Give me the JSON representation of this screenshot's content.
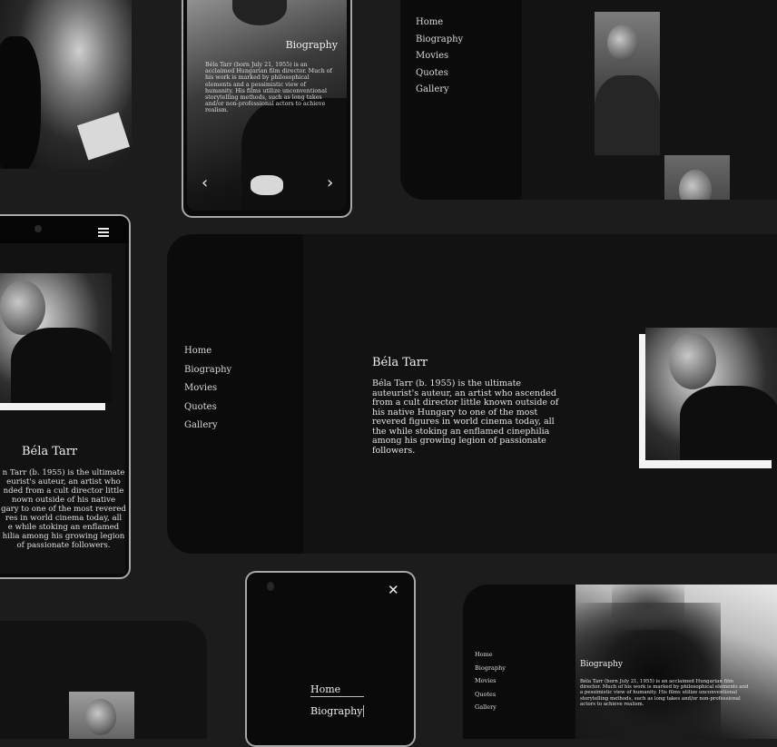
{
  "nav": {
    "items": [
      "Home",
      "Biography",
      "Movies",
      "Quotes",
      "Gallery"
    ]
  },
  "main": {
    "title": "Béla Tarr",
    "paragraph": "Béla Tarr (b. 1955) is the ultimate auteurist's auteur, an artist who ascended from a cult director little known outside of his native Hungary to one of the most revered figures in world cinema today, all the while stoking an enflamed cinephilia among his growing legion of passionate followers."
  },
  "mobile_left": {
    "title": "Béla Tarr",
    "lines": [
      "n Tarr (b. 1955) is the ultimate",
      "eurist's auteur, an artist who",
      "nded from a cult director little",
      "nown outside of his native",
      "gary to one of the most revered",
      "res in world cinema today, all",
      "e while stoking an enflamed",
      "hilia among his growing legion",
      "of passionate followers."
    ],
    "menu_icon": "hamburger-icon"
  },
  "phone_top": {
    "title": "Biography",
    "paragraph": "Béla Tarr (born July 21, 1955) is an acclaimed Hungarian film director. Much of his work is marked by philosophical elements and a pessimistic view of humanity. His films utilize unconventional storytelling methods, such as long takes and/or non-professional actors to achieve realism.",
    "prev_icon": "chevron-left-icon",
    "next_icon": "chevron-right-icon"
  },
  "phone_bottom": {
    "items": [
      "Home",
      "Biography"
    ],
    "close_icon": "close-icon"
  },
  "bottom_right": {
    "title": "Biography",
    "paragraph": "Béla Tarr (born July 21, 1955) is an acclaimed Hungarian film director. Much of his work is marked by philosophical elements and a pessimistic view of humanity. His films utilize unconventional storytelling methods, such as long takes and/or non-professional actors to achieve realism."
  }
}
